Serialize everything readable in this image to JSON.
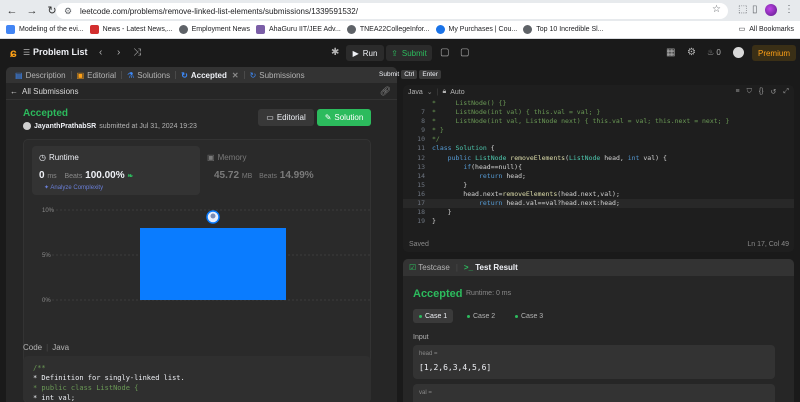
{
  "browser": {
    "url": "leetcode.com/problems/remove-linked-list-elements/submissions/1339591532/",
    "bookmarks": [
      {
        "label": "Modeling of the evi...",
        "color": "#4285f4"
      },
      {
        "label": "News - Latest News,...",
        "color": "#d32f2f"
      },
      {
        "label": "Employment News",
        "color": "#5f6368"
      },
      {
        "label": "AhaGuru IIT/JEE Adv...",
        "color": "#7b5ea7"
      },
      {
        "label": "TNEA22CollegeInfor...",
        "color": "#5f6368"
      },
      {
        "label": "My Purchases | Cou...",
        "color": "#1a73e8"
      },
      {
        "label": "Top 10 Incredible Sl...",
        "color": "#5f6368"
      }
    ],
    "all_bookmarks": "All Bookmarks"
  },
  "topbar": {
    "problem_list": "Problem List",
    "run": "Run",
    "submit": "Submit",
    "streak": "0",
    "premium": "Premium"
  },
  "left": {
    "tabs": [
      {
        "label": "Description",
        "icon": "▤"
      },
      {
        "label": "Editorial",
        "icon": "▣"
      },
      {
        "label": "Solutions",
        "icon": "⚗"
      },
      {
        "label": "Accepted",
        "icon": "↻"
      },
      {
        "label": "Submissions",
        "icon": "↻"
      }
    ],
    "all_submissions": "All Submissions",
    "status": "Accepted",
    "username": "JayanthPrathabSR",
    "submitted_at": "submitted at Jul 31, 2024 19:23",
    "editorial_btn": "Editorial",
    "solution_btn": "Solution",
    "runtime": {
      "label": "Runtime",
      "value": "0",
      "unit": "ms",
      "beats_label": "Beats",
      "beats_pct": "100.00%",
      "analyze": "Analyze Complexity"
    },
    "memory": {
      "label": "Memory",
      "value": "45.72",
      "unit": "MB",
      "beats_label": "Beats",
      "beats_pct": "14.99%"
    },
    "code_lang_header": "Code",
    "code_lang": "Java",
    "code_lines": [
      "/**",
      " * Definition for singly-linked list.",
      " * public class ListNode {",
      " *     int val;"
    ]
  },
  "chart_data": {
    "type": "bar",
    "categories": [
      "0ms"
    ],
    "values": [
      8
    ],
    "yticks": [
      "10%",
      "5%",
      "0%"
    ],
    "ylim": [
      0,
      10
    ],
    "grid": true
  },
  "editor": {
    "language": "Java",
    "mode": "Auto",
    "lines": [
      {
        "n": "",
        "text": "*     ListNode() {}"
      },
      {
        "n": "7",
        "text": "*     ListNode(int val) { this.val = val; }"
      },
      {
        "n": "8",
        "text": "*     ListNode(int val, ListNode next) { this.val = val; this.next = next; }"
      },
      {
        "n": "9",
        "text": "* }"
      },
      {
        "n": "10",
        "text": "*/"
      },
      {
        "n": "11",
        "text": "class Solution {"
      },
      {
        "n": "12",
        "text": "    public ListNode removeElements(ListNode head, int val) {"
      },
      {
        "n": "13",
        "text": "        if(head==null){"
      },
      {
        "n": "14",
        "text": "            return head;"
      },
      {
        "n": "15",
        "text": "        }"
      },
      {
        "n": "16",
        "text": "        head.next=removeElements(head.next,val);"
      },
      {
        "n": "17",
        "text": "            return head.val==val?head.next:head;"
      },
      {
        "n": "18",
        "text": "    }"
      },
      {
        "n": "19",
        "text": "}"
      }
    ],
    "saved": "Saved",
    "cursor": "Ln 17, Col 49",
    "tooltip_label": "Submit",
    "tooltip_key1": "Ctrl",
    "tooltip_key2": "Enter"
  },
  "result": {
    "tab_testcase": "Testcase",
    "tab_result": "Test Result",
    "status": "Accepted",
    "runtime": "Runtime: 0 ms",
    "cases": [
      "Case 1",
      "Case 2",
      "Case 3"
    ],
    "input_label": "Input",
    "head_name": "head =",
    "head_value": "[1,2,6,3,4,5,6]",
    "val_name": "val ="
  }
}
